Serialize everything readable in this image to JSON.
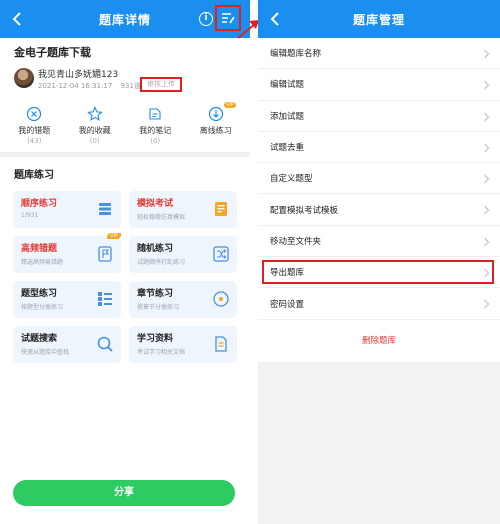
{
  "left": {
    "header": {
      "title": "题库详情",
      "info_glyph": "i"
    },
    "bank_title": "金电子题库下载",
    "author": "我见青山多妩媚123",
    "meta": {
      "date": "2021-12-04 16:31:17",
      "count": "931道"
    },
    "upload_status": "审核上传",
    "stats": [
      {
        "label": "我的错题",
        "count": "(43)",
        "icon": "x-circle-icon"
      },
      {
        "label": "我的收藏",
        "count": "(0)",
        "icon": "star-icon"
      },
      {
        "label": "我的笔记",
        "count": "(0)",
        "icon": "note-icon"
      },
      {
        "label": "离线练习",
        "count": "",
        "icon": "download-icon",
        "vip": "VIP"
      }
    ],
    "section_title": "题库练习",
    "cards": [
      {
        "title": "顺序练习",
        "sub": "1/931",
        "red": true,
        "icon": "list-icon"
      },
      {
        "title": "模拟考试",
        "sub": "轻松稳稳仿真模拟",
        "red": true,
        "icon": "exam-icon"
      },
      {
        "title": "高频错题",
        "sub": "精选高频易错题",
        "red": true,
        "icon": "flag-icon",
        "vip": "VIP"
      },
      {
        "title": "随机练习",
        "sub": "试题顺序打乱练习",
        "red": false,
        "icon": "shuffle-icon"
      },
      {
        "title": "题型练习",
        "sub": "按题型分类练习",
        "red": false,
        "icon": "category-icon"
      },
      {
        "title": "章节练习",
        "sub": "按章节分类练习",
        "red": false,
        "icon": "target-icon"
      },
      {
        "title": "试题搜索",
        "sub": "快速从题库中查找",
        "red": false,
        "icon": "search-icon"
      },
      {
        "title": "学习资料",
        "sub": "考试学习相关文档",
        "red": false,
        "icon": "document-icon"
      }
    ],
    "share_label": "分享"
  },
  "right": {
    "header": {
      "title": "题库管理"
    },
    "menu": [
      {
        "label": "编辑题库名称"
      },
      {
        "label": "编辑试题"
      },
      {
        "label": "添加试题"
      },
      {
        "label": "试题去重"
      },
      {
        "label": "自定义题型"
      },
      {
        "label": "配置模拟考试模板"
      },
      {
        "label": "移动至文件夹"
      },
      {
        "label": "导出题库",
        "highlighted": true
      },
      {
        "label": "密码设置"
      }
    ],
    "delete_label": "删除题库"
  },
  "colors": {
    "primary": "#1a8ff0",
    "highlight": "#e02020",
    "share": "#2ecb63",
    "danger": "#e53935",
    "vip": "#f5a623"
  }
}
